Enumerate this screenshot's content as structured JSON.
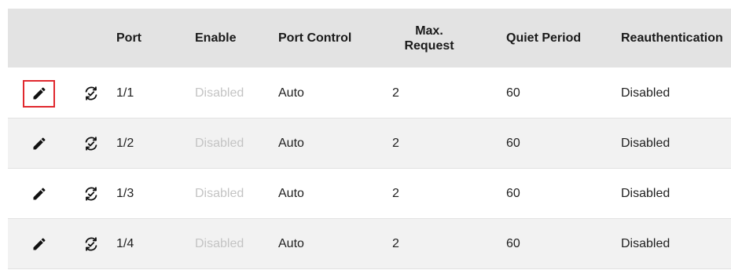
{
  "table": {
    "headers": {
      "port": "Port",
      "enable": "Enable",
      "port_control": "Port Control",
      "max_request_line1": "Max.",
      "max_request_line2": "Request",
      "quiet_period": "Quiet Period",
      "reauthentication": "Reauthentication"
    },
    "rows": [
      {
        "port": "1/1",
        "enable": "Disabled",
        "port_control": "Auto",
        "max_request": "2",
        "quiet_period": "60",
        "reauthentication": "Disabled"
      },
      {
        "port": "1/2",
        "enable": "Disabled",
        "port_control": "Auto",
        "max_request": "2",
        "quiet_period": "60",
        "reauthentication": "Disabled"
      },
      {
        "port": "1/3",
        "enable": "Disabled",
        "port_control": "Auto",
        "max_request": "2",
        "quiet_period": "60",
        "reauthentication": "Disabled"
      },
      {
        "port": "1/4",
        "enable": "Disabled",
        "port_control": "Auto",
        "max_request": "2",
        "quiet_period": "60",
        "reauthentication": "Disabled"
      }
    ],
    "row_icons": [
      "pencil-icon",
      "sync-check-icon"
    ]
  },
  "colors": {
    "header_bg": "#e3e3e3",
    "alt_row_bg": "#f2f2f2",
    "disabled_text": "#c4c4c4",
    "focus_border": "#e0282e"
  }
}
